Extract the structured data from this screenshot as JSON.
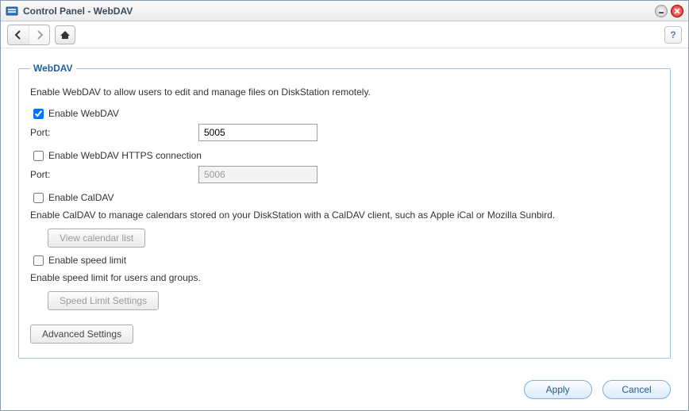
{
  "window": {
    "title": "Control Panel - WebDAV"
  },
  "panel": {
    "legend": "WebDAV",
    "description": "Enable WebDAV to allow users to edit and manage files on DiskStation remotely.",
    "enable_webdav": {
      "label": "Enable WebDAV",
      "checked": true,
      "port_label": "Port:",
      "port_value": "5005"
    },
    "enable_https": {
      "label": "Enable WebDAV HTTPS connection",
      "checked": false,
      "port_label": "Port:",
      "port_value": "5006"
    },
    "enable_caldav": {
      "label": "Enable CalDAV",
      "checked": false,
      "note": "Enable CalDAV to manage calendars stored on your DiskStation with a CalDAV client, such as Apple iCal or Mozilla Sunbird.",
      "button": "View calendar list"
    },
    "enable_speedlimit": {
      "label": "Enable speed limit",
      "checked": false,
      "note": "Enable speed limit for users and groups.",
      "button": "Speed Limit Settings"
    },
    "advanced_button": "Advanced Settings"
  },
  "footer": {
    "apply": "Apply",
    "cancel": "Cancel"
  },
  "help_glyph": "?"
}
